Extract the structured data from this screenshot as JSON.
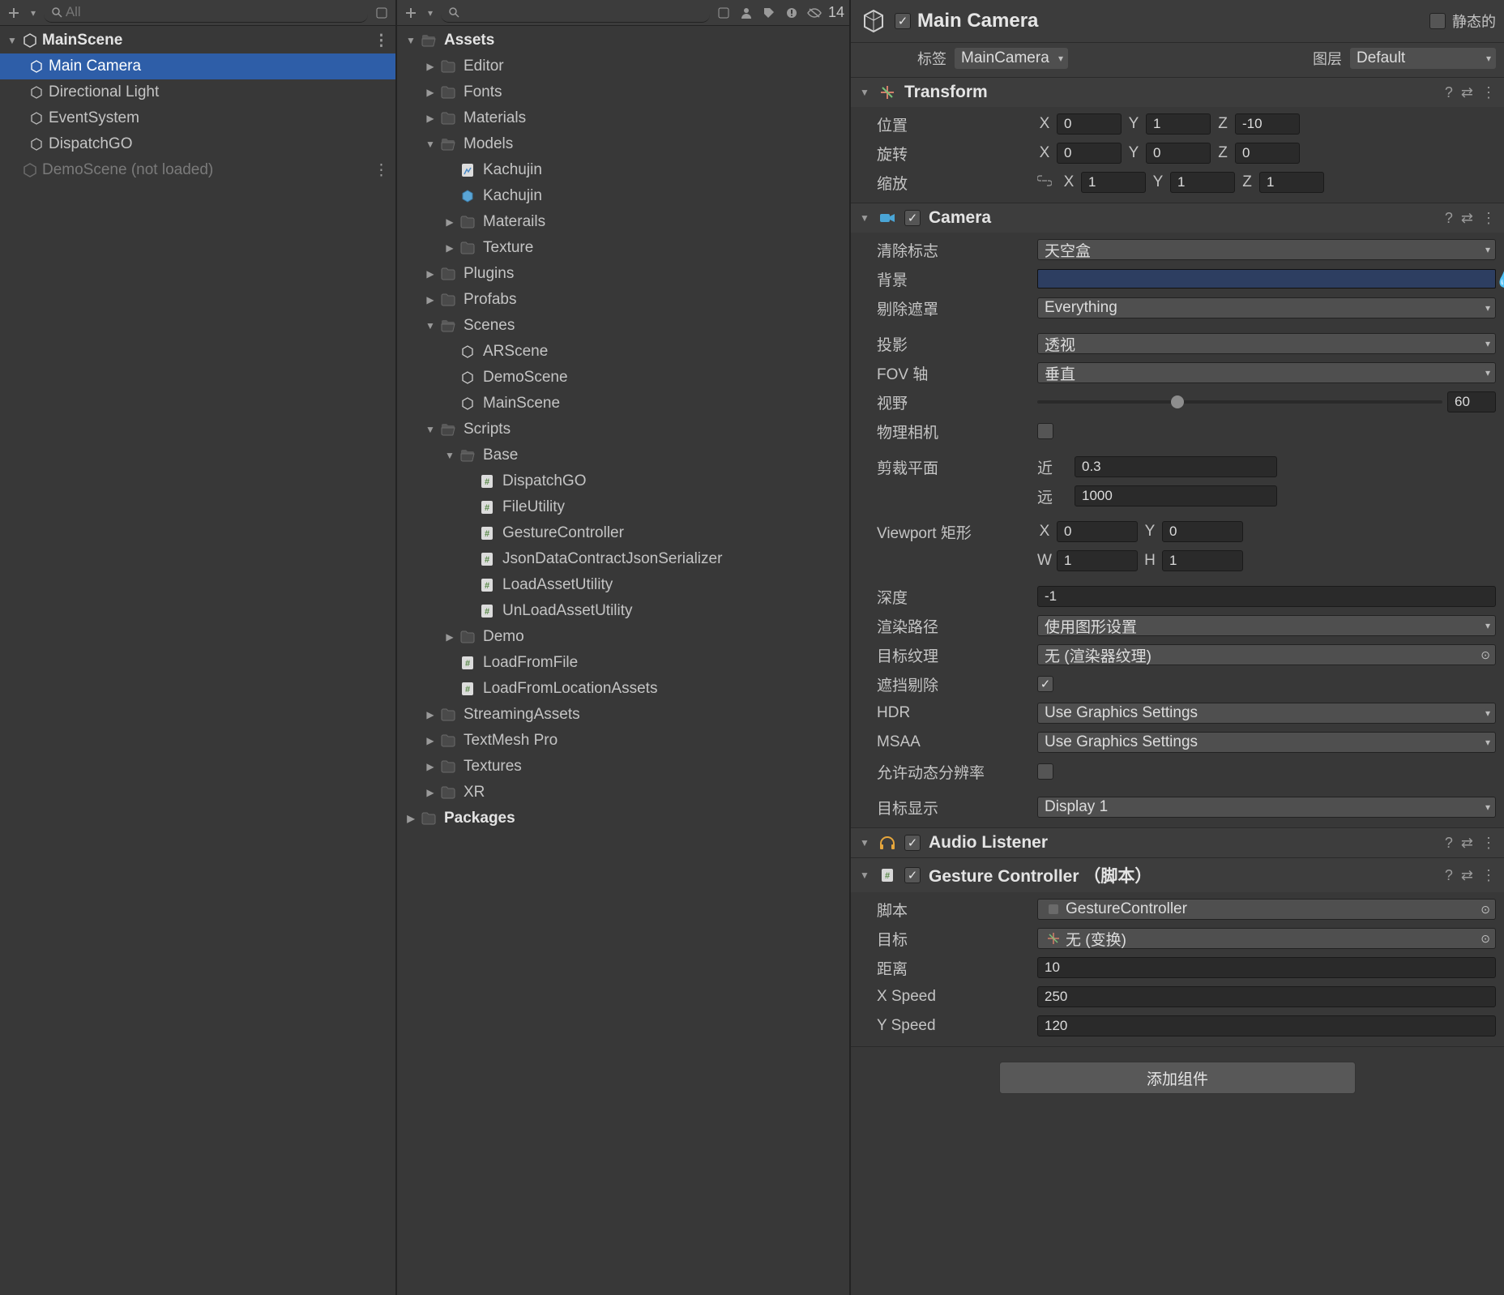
{
  "hierarchy": {
    "search_placeholder": "All",
    "scene": "MainScene",
    "items": [
      {
        "name": "Main Camera",
        "selected": true
      },
      {
        "name": "Directional Light"
      },
      {
        "name": "EventSystem"
      },
      {
        "name": "DispatchGO"
      }
    ],
    "unloaded": "DemoScene (not loaded)"
  },
  "project": {
    "hidden_count": "14",
    "root": "Assets",
    "packages": "Packages",
    "assets": [
      {
        "n": "Editor",
        "t": "folder"
      },
      {
        "n": "Fonts",
        "t": "folder"
      },
      {
        "n": "Materials",
        "t": "folder"
      },
      {
        "n": "Models",
        "t": "folder",
        "open": true,
        "c": [
          {
            "n": "Kachujin",
            "t": "asset-mesh"
          },
          {
            "n": "Kachujin",
            "t": "prefab"
          },
          {
            "n": "Materails",
            "t": "folder"
          },
          {
            "n": "Texture",
            "t": "folder"
          }
        ]
      },
      {
        "n": "Plugins",
        "t": "folder"
      },
      {
        "n": "Profabs",
        "t": "folder"
      },
      {
        "n": "Scenes",
        "t": "folder",
        "open": true,
        "c": [
          {
            "n": "ARScene",
            "t": "scene"
          },
          {
            "n": "DemoScene",
            "t": "scene"
          },
          {
            "n": "MainScene",
            "t": "scene"
          }
        ]
      },
      {
        "n": "Scripts",
        "t": "folder",
        "open": true,
        "c": [
          {
            "n": "Base",
            "t": "folder",
            "open": true,
            "c": [
              {
                "n": "DispatchGO",
                "t": "script"
              },
              {
                "n": "FileUtility",
                "t": "script"
              },
              {
                "n": "GestureController",
                "t": "script"
              },
              {
                "n": "JsonDataContractJsonSerializer",
                "t": "script"
              },
              {
                "n": "LoadAssetUtility",
                "t": "script"
              },
              {
                "n": "UnLoadAssetUtility",
                "t": "script"
              }
            ]
          },
          {
            "n": "Demo",
            "t": "folder"
          },
          {
            "n": "LoadFromFile",
            "t": "script"
          },
          {
            "n": "LoadFromLocationAssets",
            "t": "script"
          }
        ]
      },
      {
        "n": "StreamingAssets",
        "t": "folder"
      },
      {
        "n": "TextMesh Pro",
        "t": "folder"
      },
      {
        "n": "Textures",
        "t": "folder"
      },
      {
        "n": "XR",
        "t": "folder"
      }
    ]
  },
  "inspector": {
    "go_name": "Main Camera",
    "static_label": "静态的",
    "tag_label": "标签",
    "tag_value": "MainCamera",
    "layer_label": "图层",
    "layer_value": "Default",
    "transform": {
      "title": "Transform",
      "pos_label": "位置",
      "rot_label": "旋转",
      "scale_label": "缩放",
      "pos": {
        "x": "0",
        "y": "1",
        "z": "-10"
      },
      "rot": {
        "x": "0",
        "y": "0",
        "z": "0"
      },
      "scale": {
        "x": "1",
        "y": "1",
        "z": "1"
      }
    },
    "camera": {
      "title": "Camera",
      "clear_flags_label": "清除标志",
      "clear_flags": "天空盒",
      "background_label": "背景",
      "culling_label": "剔除遮罩",
      "culling": "Everything",
      "projection_label": "投影",
      "projection": "透视",
      "fov_axis_label": "FOV 轴",
      "fov_axis": "垂直",
      "fov_label": "视野",
      "fov": "60",
      "physical_label": "物理相机",
      "clip_label": "剪裁平面",
      "near_label": "近",
      "far_label": "远",
      "near": "0.3",
      "far": "1000",
      "viewport_label": "Viewport 矩形",
      "vx": "0",
      "vy": "0",
      "vw": "1",
      "vh": "1",
      "depth_label": "深度",
      "depth": "-1",
      "render_path_label": "渲染路径",
      "render_path": "使用图形设置",
      "target_tex_label": "目标纹理",
      "target_tex": "无 (渲染器纹理)",
      "occlusion_label": "遮挡剔除",
      "hdr_label": "HDR",
      "hdr": "Use Graphics Settings",
      "msaa_label": "MSAA",
      "msaa": "Use Graphics Settings",
      "dynres_label": "允许动态分辨率",
      "target_display_label": "目标显示",
      "target_display": "Display 1"
    },
    "audio": {
      "title": "Audio Listener"
    },
    "gesture": {
      "title": "Gesture Controller （脚本）",
      "script_label": "脚本",
      "script": "GestureController",
      "target_label": "目标",
      "target": "无 (变换)",
      "distance_label": "距离",
      "distance": "10",
      "xspeed_label": "X Speed",
      "xspeed": "250",
      "yspeed_label": "Y Speed",
      "yspeed": "120"
    },
    "add_component": "添加组件"
  }
}
